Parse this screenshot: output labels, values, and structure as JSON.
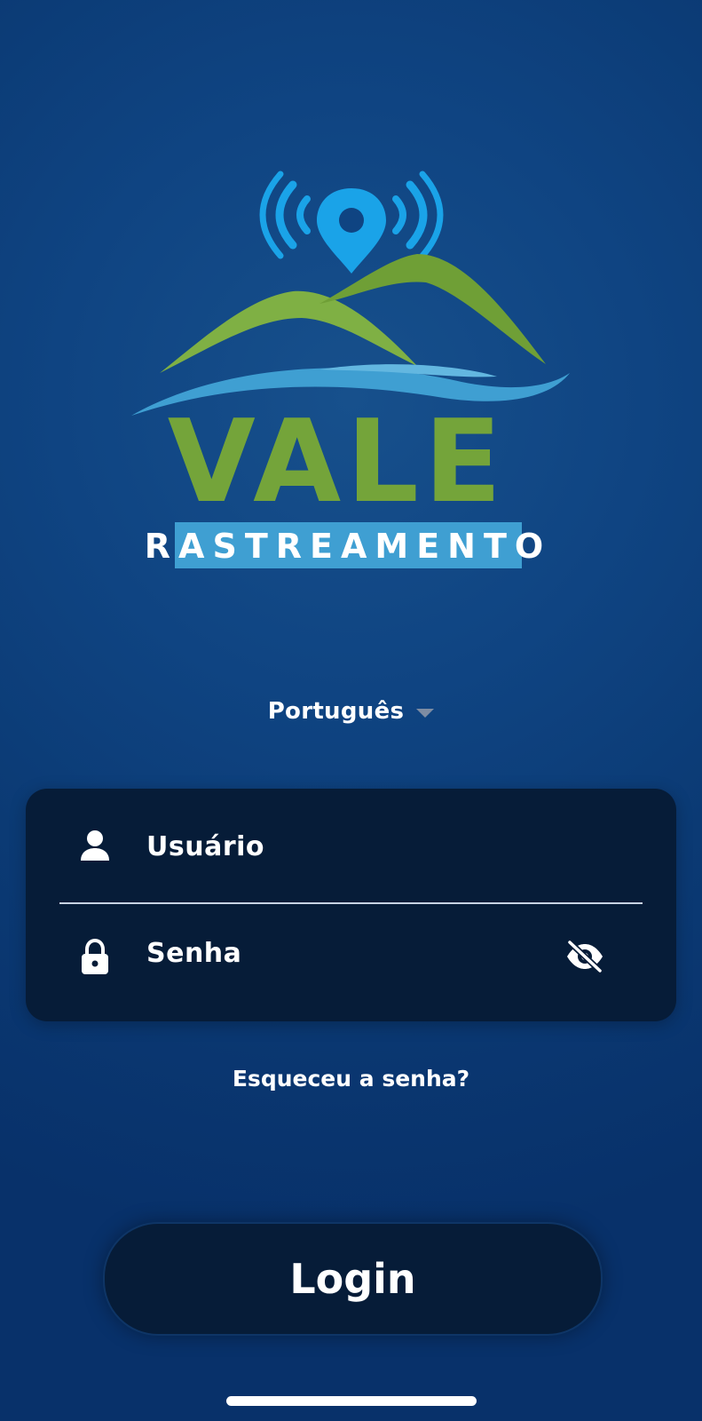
{
  "brand": {
    "name": "VALE",
    "tagline": "RASTREAMENTO",
    "colors": {
      "green": "#74a43a",
      "light_blue": "#3f9fd2",
      "pin_blue": "#1aa3e8",
      "tagline_bg": "#3f9fd2"
    }
  },
  "language": {
    "selected": "Português"
  },
  "form": {
    "username_placeholder": "Usuário",
    "password_placeholder": "Senha"
  },
  "links": {
    "forgot_password": "Esqueceu a senha?"
  },
  "actions": {
    "login_label": "Login"
  },
  "icons": {
    "user": "user-icon",
    "lock": "lock-icon",
    "visibility": "eye-off-icon",
    "dropdown": "caret-down-icon",
    "pin": "location-pin-icon"
  }
}
